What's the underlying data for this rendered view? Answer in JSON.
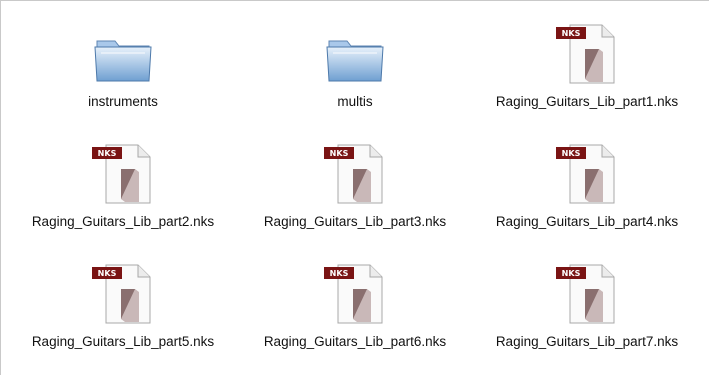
{
  "window": {
    "view": "icon-grid"
  },
  "items": [
    {
      "name": "instruments",
      "kind": "folder",
      "icon": "folder-icon"
    },
    {
      "name": "multis",
      "kind": "folder",
      "icon": "folder-icon"
    },
    {
      "name": "Raging_Guitars_Lib_part1.nks",
      "kind": "nks-file",
      "icon": "nks-file-icon",
      "badge": "NKS"
    },
    {
      "name": "Raging_Guitars_Lib_part2.nks",
      "kind": "nks-file",
      "icon": "nks-file-icon",
      "badge": "NKS"
    },
    {
      "name": "Raging_Guitars_Lib_part3.nks",
      "kind": "nks-file",
      "icon": "nks-file-icon",
      "badge": "NKS"
    },
    {
      "name": "Raging_Guitars_Lib_part4.nks",
      "kind": "nks-file",
      "icon": "nks-file-icon",
      "badge": "NKS"
    },
    {
      "name": "Raging_Guitars_Lib_part5.nks",
      "kind": "nks-file",
      "icon": "nks-file-icon",
      "badge": "NKS"
    },
    {
      "name": "Raging_Guitars_Lib_part6.nks",
      "kind": "nks-file",
      "icon": "nks-file-icon",
      "badge": "NKS"
    },
    {
      "name": "Raging_Guitars_Lib_part7.nks",
      "kind": "nks-file",
      "icon": "nks-file-icon",
      "badge": "NKS"
    }
  ],
  "colors": {
    "folder_light": "#cfe3f7",
    "folder_dark": "#6f9fd1",
    "nks_badge": "#7a1414",
    "nks_block": "#8a6f6f",
    "page_border": "#9a9a9a"
  }
}
